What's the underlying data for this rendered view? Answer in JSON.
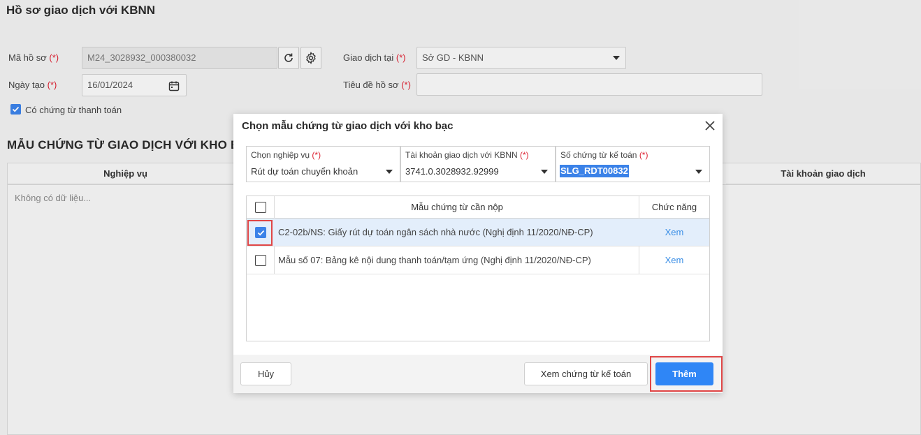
{
  "page": {
    "title": "Hồ sơ giao dịch với KBNN",
    "ma_ho_so_label": "Mã hồ sơ",
    "ma_ho_so_value": "M24_3028932_000380032",
    "ngay_tao_label": "Ngày tạo",
    "ngay_tao_value": "16/01/2024",
    "giao_dich_tai_label": "Giao dịch tại",
    "giao_dich_tai_value": "Sở GD - KBNN",
    "tieu_de_label": "Tiêu đề hồ sơ",
    "tieu_de_value": "",
    "required_mark": "(*)",
    "co_chung_tu_label": "Có chứng từ thanh toán",
    "co_chung_tu_checked": true,
    "section_title": "MẪU CHỨNG TỪ GIAO DỊCH VỚI KHO BA",
    "table_col_nghiep_vu": "Nghiệp vụ",
    "table_col_tai_khoan": "Tài khoản giao dịch",
    "table_empty": "Không có dữ liệu..."
  },
  "dialog": {
    "title": "Chọn mẫu chứng từ giao dịch với kho bạc",
    "fields": [
      {
        "label": "Chọn nghiệp vụ",
        "value": "Rút dự toán chuyển khoản"
      },
      {
        "label": "Tài khoản giao dịch với KBNN",
        "value": "3741.0.3028932.92999"
      },
      {
        "label": "Số chứng từ kế toán",
        "value": "SLG_RDT00832"
      }
    ],
    "grid": {
      "col_title": "Mẫu chứng từ cần nộp",
      "col_func": "Chức năng",
      "rows": [
        {
          "text": "C2-02b/NS: Giấy rút dự toán ngân sách nhà nước (Nghị định 11/2020/NĐ-CP)",
          "link": "Xem",
          "checked": true
        },
        {
          "text": "Mẫu số 07: Bảng kê nội dung thanh toán/tạm ứng (Nghị định 11/2020/NĐ-CP)",
          "link": "Xem",
          "checked": false
        }
      ]
    },
    "buttons": {
      "cancel": "Hủy",
      "view": "Xem chứng từ kế toán",
      "add": "Thêm"
    }
  },
  "colors": {
    "primary": "#2f86f6",
    "highlight_row": "#e3eefb",
    "annotation_red": "#e04646",
    "link": "#3a8ee6"
  }
}
